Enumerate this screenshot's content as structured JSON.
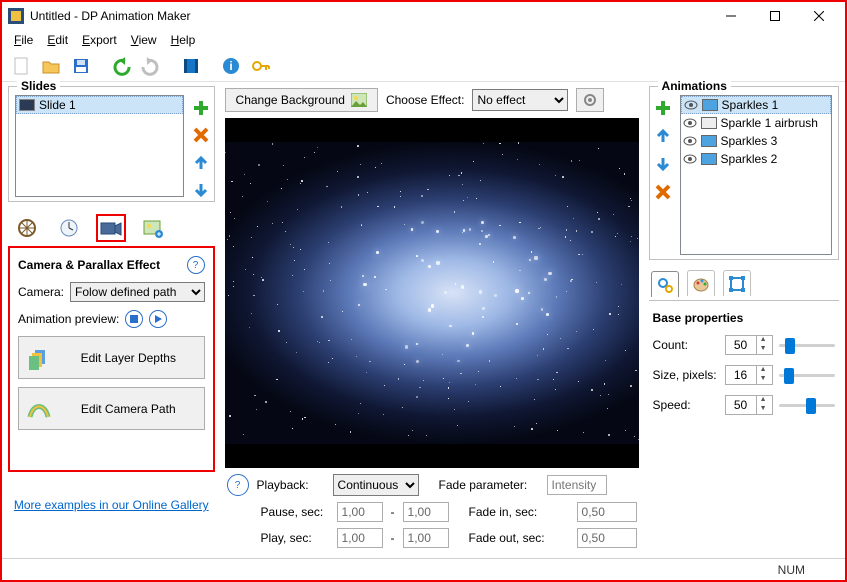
{
  "window": {
    "title": "Untitled - DP Animation Maker"
  },
  "menu": {
    "file": "File",
    "edit": "Edit",
    "export": "Export",
    "view": "View",
    "help": "Help"
  },
  "slides": {
    "legend": "Slides",
    "items": [
      "Slide 1"
    ]
  },
  "camera": {
    "panel_title": "Camera & Parallax Effect",
    "camera_label": "Camera:",
    "camera_value": "Folow defined path",
    "preview_label": "Animation preview:",
    "edit_depths": "Edit Layer Depths",
    "edit_path": "Edit Camera Path"
  },
  "gallery_link": "More examples in our Online Gallery",
  "center": {
    "change_bg": "Change Background",
    "choose_effect_label": "Choose Effect:",
    "effect_value": "No effect"
  },
  "playback": {
    "label": "Playback:",
    "mode": "Continuous",
    "pause_label": "Pause, sec:",
    "play_label": "Play, sec:",
    "pause_a": "1,00",
    "pause_b": "1,00",
    "play_a": "1,00",
    "play_b": "1,00",
    "dash": "-",
    "fade_param_label": "Fade parameter:",
    "fade_param_ph": "Intensity",
    "fade_in_label": "Fade in, sec:",
    "fade_out_label": "Fade out, sec:",
    "fade_in": "0,50",
    "fade_out": "0,50"
  },
  "animations": {
    "legend": "Animations",
    "items": [
      {
        "name": "Sparkles 1",
        "type": "layer",
        "selected": true
      },
      {
        "name": "Sparkle 1 airbrush",
        "type": "brush",
        "selected": false
      },
      {
        "name": "Sparkles 3",
        "type": "layer",
        "selected": false
      },
      {
        "name": "Sparkles 2",
        "type": "layer",
        "selected": false
      }
    ]
  },
  "props": {
    "title": "Base properties",
    "count_label": "Count:",
    "count": "50",
    "size_label": "Size, pixels:",
    "size": "16",
    "speed_label": "Speed:",
    "speed": "50"
  },
  "status": {
    "num": "NUM"
  },
  "colors": {
    "accent": "#0078d7",
    "highlight_border": "#e00"
  }
}
